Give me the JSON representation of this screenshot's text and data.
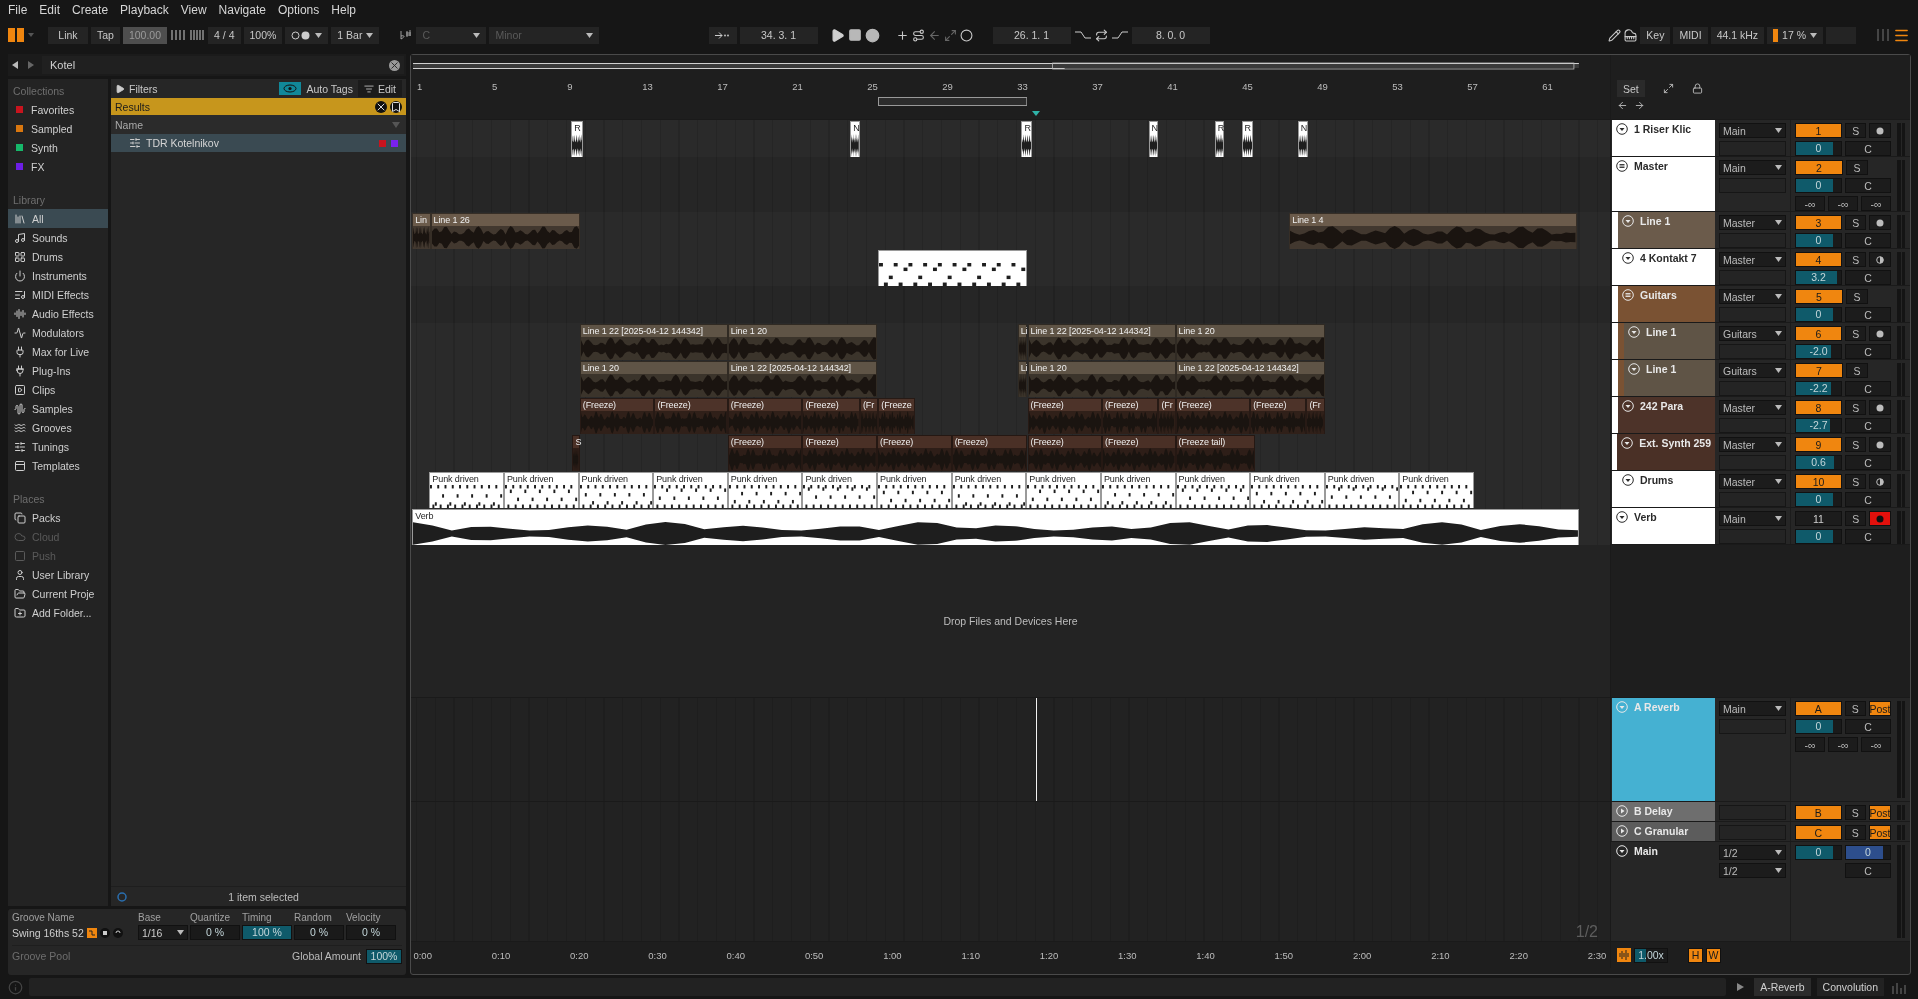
{
  "menu": [
    "File",
    "Edit",
    "Create",
    "Playback",
    "View",
    "Navigate",
    "Options",
    "Help"
  ],
  "toolbar": {
    "link": "Link",
    "tap": "Tap",
    "tempo": "100.00",
    "signature": "4 / 4",
    "zoom": "100%",
    "quantize": "1 Bar",
    "key": {
      "root": "C",
      "scale": "Minor",
      "disabled": true
    },
    "position": "34. 3. 1",
    "loop_start": "26. 1. 1",
    "loop_length": "8. 0. 0",
    "key_button": "Key",
    "midi_button": "MIDI",
    "sample_rate": "44.1 kHz",
    "cpu": "17 %"
  },
  "browser": {
    "search": "Kotel",
    "collections_title": "Collections",
    "collections": [
      {
        "label": "Favorites",
        "color": "#c8141e"
      },
      {
        "label": "Sampled",
        "color": "#d9770f"
      },
      {
        "label": "Synth",
        "color": "#16b86a"
      },
      {
        "label": "FX",
        "color": "#6d1ee6"
      }
    ],
    "library_title": "Library",
    "library": [
      {
        "label": "All",
        "selected": true
      },
      {
        "label": "Sounds",
        "selected": false
      },
      {
        "label": "Drums",
        "selected": false
      },
      {
        "label": "Instruments",
        "selected": false
      },
      {
        "label": "MIDI Effects",
        "selected": false
      },
      {
        "label": "Audio Effects",
        "selected": false
      },
      {
        "label": "Modulators",
        "selected": false
      },
      {
        "label": "Max for Live",
        "selected": false
      },
      {
        "label": "Plug-Ins",
        "selected": false
      },
      {
        "label": "Clips",
        "selected": false
      },
      {
        "label": "Samples",
        "selected": false
      },
      {
        "label": "Grooves",
        "selected": false
      },
      {
        "label": "Tunings",
        "selected": false
      },
      {
        "label": "Templates",
        "selected": false
      }
    ],
    "places_title": "Places",
    "places": [
      {
        "label": "Packs",
        "disabled": false
      },
      {
        "label": "Cloud",
        "disabled": true
      },
      {
        "label": "Push",
        "disabled": true
      },
      {
        "label": "User Library",
        "disabled": false
      },
      {
        "label": "Current Proje",
        "disabled": false
      },
      {
        "label": "Add Folder...",
        "disabled": false
      }
    ],
    "filters": "Filters",
    "auto_tags": {
      "label": "Auto Tags",
      "on": true
    },
    "edit": "Edit",
    "results": "Results",
    "name_column": "Name",
    "items": [
      {
        "name": "TDR Kotelnikov",
        "selected": true,
        "tags": [
          {
            "color": "#c8141e"
          },
          {
            "color": "#7a22ee"
          }
        ]
      }
    ],
    "footer": "1 item selected"
  },
  "groove": {
    "columns": [
      "Groove Name",
      "Base",
      "Quantize",
      "Timing",
      "Random",
      "Velocity"
    ],
    "rows": [
      {
        "name": "Swing 16ths 52",
        "base": "1/16",
        "quantize": {
          "value": "0 %",
          "level": 0
        },
        "timing": {
          "value": "100 %",
          "level": 1
        },
        "random": {
          "value": "0 %",
          "level": 0
        },
        "velocity": {
          "value": "0 %",
          "level": 0
        }
      }
    ],
    "pool_label": "Groove Pool",
    "global_label": "Global Amount",
    "global_amount": {
      "value": "100%",
      "level": 1
    }
  },
  "arrangement": {
    "ruler": [
      "1",
      "5",
      "9",
      "13",
      "17",
      "21",
      "25",
      "29",
      "33",
      "37",
      "41",
      "45",
      "49",
      "53",
      "57",
      "61"
    ],
    "set": "Set",
    "tracks": [
      {
        "name": "1 Riser Klic",
        "color": "#ffffff",
        "kind": "track",
        "expanded": true,
        "output": "Main",
        "number": "1",
        "number_on": true,
        "solo": "S",
        "arm": {
          "kind": "record",
          "armed": false
        },
        "volume": {
          "value": "0",
          "level": 0.83
        },
        "crossfade": "C",
        "clips": [
          {
            "name": "R",
            "kind": "audio"
          },
          {
            "name": "N",
            "kind": "audio"
          },
          {
            "name": "R",
            "kind": "audio"
          },
          {
            "name": "N",
            "kind": "audio"
          },
          {
            "name": "R",
            "kind": "audio"
          },
          {
            "name": "R",
            "kind": "audio"
          },
          {
            "name": "N",
            "kind": "audio"
          }
        ]
      },
      {
        "name": "Master",
        "color": "#ffffff",
        "kind": "group",
        "expanded": true,
        "output": "Main",
        "number": "2",
        "number_on": true,
        "solo": "S",
        "volume": {
          "value": "0",
          "level": 0.83
        },
        "crossfade": "C",
        "sends": [
          "-∞",
          "-∞",
          "-∞"
        ],
        "children": [
          {
            "name": "Line 1",
            "color": "#6b5b4b",
            "kind": "track",
            "expanded": true,
            "output": "Master",
            "number": "3",
            "number_on": true,
            "solo": "S",
            "arm": {
              "kind": "record",
              "armed": false
            },
            "volume": {
              "value": "0",
              "level": 0.83
            },
            "crossfade": "C",
            "clips": [
              {
                "name": "Lin",
                "kind": "audio"
              },
              {
                "name": "Line 1 26",
                "kind": "audio"
              },
              {
                "name": "Line 1 4",
                "kind": "audio"
              }
            ]
          },
          {
            "name": "4 Kontakt 7",
            "color": "#ffffff",
            "kind": "track",
            "expanded": true,
            "output": "Master",
            "number": "4",
            "number_on": true,
            "solo": "S",
            "arm": {
              "kind": "monitor"
            },
            "volume": {
              "value": "3.2",
              "level": 0.91
            },
            "crossfade": "C",
            "clips": [
              {
                "kind": "midi"
              }
            ]
          },
          {
            "name": "Guitars",
            "color": "#7a5233",
            "kind": "group",
            "expanded": true,
            "output": "Master",
            "number": "5",
            "number_on": true,
            "solo": "S",
            "volume": {
              "value": "0",
              "level": 0.83
            },
            "crossfade": "C",
            "children": [
              {
                "name": "Line 1",
                "color": "#5f5446",
                "kind": "track",
                "expanded": true,
                "output": "Guitars",
                "number": "6",
                "number_on": true,
                "solo": "S",
                "arm": {
                  "kind": "record",
                  "armed": false
                },
                "volume": {
                  "value": "-2.0",
                  "level": 0.78
                },
                "crossfade": "C",
                "clips": [
                  {
                    "name": "Line 1 22 [2025-04-12 144342]",
                    "kind": "audio"
                  },
                  {
                    "name": "Line 1 20",
                    "kind": "audio"
                  },
                  {
                    "name": "Li",
                    "kind": "audio"
                  },
                  {
                    "name": "Line 1 22 [2025-04-12 144342]",
                    "kind": "audio"
                  },
                  {
                    "name": "Line 1 20",
                    "kind": "audio"
                  }
                ]
              },
              {
                "name": "Line 1",
                "color": "#5f5446",
                "kind": "track",
                "expanded": true,
                "output": "Guitars",
                "number": "7",
                "number_on": true,
                "solo": "S",
                "volume": {
                  "value": "-2.2",
                  "level": 0.77
                },
                "crossfade": "C",
                "clips": [
                  {
                    "name": "Line 1 20",
                    "kind": "audio"
                  },
                  {
                    "name": "Line 1 22 [2025-04-12 144342]",
                    "kind": "audio"
                  },
                  {
                    "name": "Li",
                    "kind": "audio"
                  },
                  {
                    "name": "Line 1 20",
                    "kind": "audio"
                  },
                  {
                    "name": "Line 1 22 [2025-04-12 144342]",
                    "kind": "audio"
                  }
                ]
              }
            ]
          },
          {
            "name": "242 Para",
            "color": "#4d3329",
            "kind": "track",
            "expanded": true,
            "output": "Master",
            "number": "8",
            "number_on": true,
            "solo": "S",
            "arm": {
              "kind": "record",
              "armed": false
            },
            "volume": {
              "value": "-2.7",
              "level": 0.76
            },
            "crossfade": "C",
            "clips": [
              {
                "name": "(Freeze)",
                "kind": "audio"
              },
              {
                "name": "(Freeze)",
                "kind": "audio"
              },
              {
                "name": "(Freeze)",
                "kind": "audio"
              },
              {
                "name": "(Freeze)",
                "kind": "audio"
              },
              {
                "name": "(Fr",
                "kind": "audio"
              },
              {
                "name": "(Freeze",
                "kind": "audio"
              },
              {
                "name": "(Freeze)",
                "kind": "audio"
              },
              {
                "name": "(Freeze)",
                "kind": "audio"
              },
              {
                "name": "(Fr",
                "kind": "audio"
              },
              {
                "name": "(Freeze)",
                "kind": "audio"
              },
              {
                "name": "(Freeze)",
                "kind": "audio"
              },
              {
                "name": "(Fr",
                "kind": "audio"
              }
            ]
          },
          {
            "name": "Ext. Synth 259",
            "color": "#4a3026",
            "kind": "track",
            "expanded": true,
            "output": "Master",
            "number": "9",
            "number_on": true,
            "solo": "S",
            "arm": {
              "kind": "record",
              "armed": false
            },
            "volume": {
              "value": "0.6",
              "level": 0.85
            },
            "crossfade": "C",
            "clips": [
              {
                "name": "S",
                "kind": "audio"
              },
              {
                "name": "(Freeze)",
                "kind": "audio"
              },
              {
                "name": "(Freeze)",
                "kind": "audio"
              },
              {
                "name": "(Freeze)",
                "kind": "audio"
              },
              {
                "name": "(Freeze)",
                "kind": "audio"
              },
              {
                "name": "(Freeze)",
                "kind": "audio"
              },
              {
                "name": "(Freeze)",
                "kind": "audio"
              },
              {
                "name": "(Freeze tail)",
                "kind": "audio"
              }
            ]
          },
          {
            "name": "Drums",
            "color": "#ffffff",
            "kind": "track",
            "expanded": true,
            "output": "Master",
            "number": "10",
            "number_on": true,
            "solo": "S",
            "arm": {
              "kind": "monitor"
            },
            "volume": {
              "value": "0",
              "level": 0.83
            },
            "crossfade": "C",
            "clips": [
              {
                "name": "Punk driven",
                "kind": "midi"
              },
              {
                "name": "Punk driven",
                "kind": "midi"
              },
              {
                "name": "Punk driven",
                "kind": "midi"
              },
              {
                "name": "Punk driven",
                "kind": "midi"
              },
              {
                "name": "Punk driven",
                "kind": "midi"
              },
              {
                "name": "Punk driven",
                "kind": "midi"
              },
              {
                "name": "Punk driven",
                "kind": "midi"
              },
              {
                "name": "Punk driven",
                "kind": "midi"
              },
              {
                "name": "Punk driven",
                "kind": "midi"
              },
              {
                "name": "Punk driven",
                "kind": "midi"
              },
              {
                "name": "Punk driven",
                "kind": "midi"
              },
              {
                "name": "Punk driven",
                "kind": "midi"
              },
              {
                "name": "Punk driven",
                "kind": "midi"
              },
              {
                "name": "Punk driven",
                "kind": "midi"
              }
            ]
          }
        ]
      },
      {
        "name": "Verb",
        "color": "#ffffff",
        "kind": "track",
        "expanded": true,
        "output": "Main",
        "number": "11",
        "number_on": false,
        "solo": "S",
        "arm": {
          "kind": "record",
          "armed": true
        },
        "volume": {
          "value": "0",
          "level": 0.83
        },
        "crossfade": "C",
        "clips": [
          {
            "name": "Verb",
            "kind": "audio"
          }
        ]
      }
    ],
    "drop_hint": "Drop Files and Devices Here",
    "returns": [
      {
        "name": "A Reverb",
        "color": "#45b1d2",
        "kind": "return",
        "expanded": true,
        "output": "Main",
        "number": "A",
        "number_on": true,
        "solo": "S",
        "post": "Post",
        "volume": {
          "value": "0",
          "level": 0.83
        },
        "crossfade": "C",
        "sends": [
          "-∞",
          "-∞",
          "-∞"
        ]
      },
      {
        "name": "B Delay",
        "color": "#6e6e6e",
        "kind": "return",
        "expanded": false,
        "number": "B",
        "number_on": true,
        "solo": "S",
        "post": "Post"
      },
      {
        "name": "C Granular",
        "color": "#5c5c5c",
        "kind": "return",
        "expanded": false,
        "number": "C",
        "number_on": true,
        "solo": "S",
        "post": "Post"
      },
      {
        "name": "Main",
        "color": "#262626",
        "kind": "main",
        "expanded": true,
        "inputs": [
          "1/2",
          "1/2"
        ],
        "volume": {
          "value": "0",
          "level": 0.83
        },
        "cue": {
          "value": "0",
          "level": 0.85
        },
        "crossfade": "C"
      }
    ],
    "page": "1/2",
    "time_ruler": [
      "0:00",
      "0:10",
      "0:20",
      "0:30",
      "0:40",
      "0:50",
      "1:00",
      "1:10",
      "1:20",
      "1:30",
      "1:40",
      "1:50",
      "2:00",
      "2:10",
      "2:20",
      "2:30"
    ],
    "warp_rate": {
      "value": "1.00x",
      "level": 0.35
    },
    "h_button": "H",
    "w_button": "W"
  },
  "status": {
    "device_tabs": [
      "A-Reverb",
      "Convolution"
    ]
  }
}
